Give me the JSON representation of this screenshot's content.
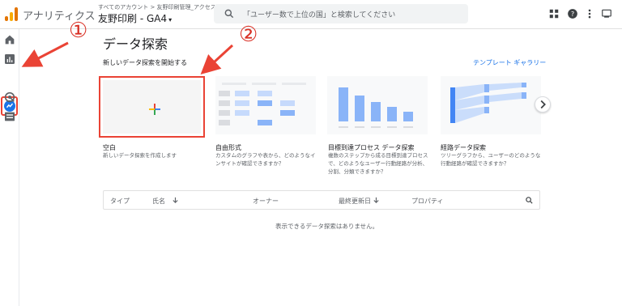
{
  "header": {
    "app_name": "アナリティクス",
    "breadcrumb": "すべてのアカウント > 友野印刷管理_アクセス解析",
    "property": "友野印刷 - GA4",
    "property_caret": "▾",
    "search_placeholder": "「ユーザー数で上位の国」と検索してください"
  },
  "annotations": {
    "one": "①",
    "two": "②"
  },
  "page": {
    "title": "データ探索",
    "subtitle": "新しいデータ探索を開始する",
    "gallery_link": "テンプレート ギャラリー"
  },
  "templates": [
    {
      "title": "空白",
      "desc": "新しいデータ探索を作成します"
    },
    {
      "title": "自由形式",
      "desc": "カスタムのグラフや表から、どのようなインサイトが確認できますか？"
    },
    {
      "title": "目標到達プロセス データ探索",
      "desc": "複数のステップから成る目標到達プロセスで、どのようなユーザー行動経路が分析、分割、分類できますか？"
    },
    {
      "title": "経路データ探索",
      "desc": "ツリーグラフから、ユーザーのどのような行動経路が確認できますか？"
    }
  ],
  "table": {
    "columns": [
      "タイプ",
      "氏名",
      "オーナー",
      "最終更新日",
      "プロパティ"
    ],
    "empty_message": "表示できるデータ探索はありません。"
  },
  "colors": {
    "accent": "#1a73e8",
    "annotation": "#ea4335"
  }
}
